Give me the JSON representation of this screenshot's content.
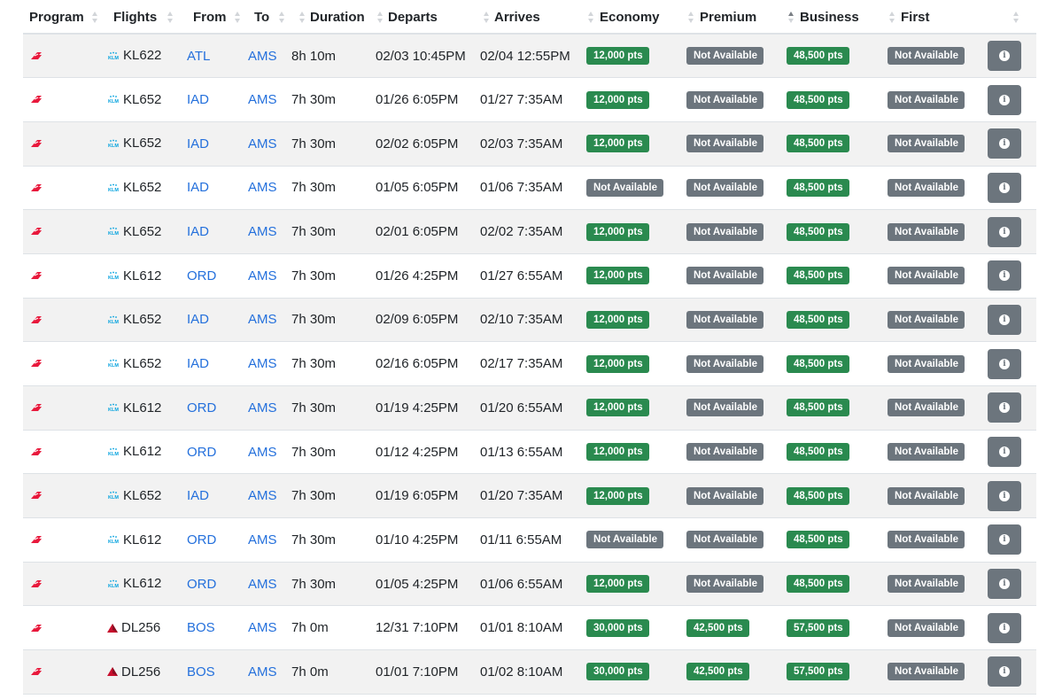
{
  "columns": [
    {
      "label": "Program"
    },
    {
      "label": "Flights"
    },
    {
      "label": "From"
    },
    {
      "label": "To"
    },
    {
      "label": "Duration"
    },
    {
      "label": "Departs"
    },
    {
      "label": "Arrives"
    },
    {
      "label": "Economy"
    },
    {
      "label": "Premium"
    },
    {
      "label": "Business",
      "sorted": "asc"
    },
    {
      "label": "First"
    },
    {
      "label": ""
    }
  ],
  "colors": {
    "available_badge": "#2a8a4f",
    "unavailable_badge": "#6c757d",
    "airport_link": "#2470dc",
    "program_logo": "#e8193c"
  },
  "rows": [
    {
      "program_icon": "program-logo-icon",
      "airline_icon": "klm-logo-icon",
      "flight": "KL622",
      "from": "ATL",
      "to": "AMS",
      "duration": "8h 10m",
      "departs": "02/03 10:45PM",
      "arrives": "02/04 12:55PM",
      "economy": "12,000 pts",
      "premium": "Not Available",
      "business": "48,500 pts",
      "first": "Not Available"
    },
    {
      "program_icon": "program-logo-icon",
      "airline_icon": "klm-logo-icon",
      "flight": "KL652",
      "from": "IAD",
      "to": "AMS",
      "duration": "7h 30m",
      "departs": "01/26 6:05PM",
      "arrives": "01/27 7:35AM",
      "economy": "12,000 pts",
      "premium": "Not Available",
      "business": "48,500 pts",
      "first": "Not Available"
    },
    {
      "program_icon": "program-logo-icon",
      "airline_icon": "klm-logo-icon",
      "flight": "KL652",
      "from": "IAD",
      "to": "AMS",
      "duration": "7h 30m",
      "departs": "02/02 6:05PM",
      "arrives": "02/03 7:35AM",
      "economy": "12,000 pts",
      "premium": "Not Available",
      "business": "48,500 pts",
      "first": "Not Available"
    },
    {
      "program_icon": "program-logo-icon",
      "airline_icon": "klm-logo-icon",
      "flight": "KL652",
      "from": "IAD",
      "to": "AMS",
      "duration": "7h 30m",
      "departs": "01/05 6:05PM",
      "arrives": "01/06 7:35AM",
      "economy": "Not Available",
      "premium": "Not Available",
      "business": "48,500 pts",
      "first": "Not Available"
    },
    {
      "program_icon": "program-logo-icon",
      "airline_icon": "klm-logo-icon",
      "flight": "KL652",
      "from": "IAD",
      "to": "AMS",
      "duration": "7h 30m",
      "departs": "02/01 6:05PM",
      "arrives": "02/02 7:35AM",
      "economy": "12,000 pts",
      "premium": "Not Available",
      "business": "48,500 pts",
      "first": "Not Available"
    },
    {
      "program_icon": "program-logo-icon",
      "airline_icon": "klm-logo-icon",
      "flight": "KL612",
      "from": "ORD",
      "to": "AMS",
      "duration": "7h 30m",
      "departs": "01/26 4:25PM",
      "arrives": "01/27 6:55AM",
      "economy": "12,000 pts",
      "premium": "Not Available",
      "business": "48,500 pts",
      "first": "Not Available"
    },
    {
      "program_icon": "program-logo-icon",
      "airline_icon": "klm-logo-icon",
      "flight": "KL652",
      "from": "IAD",
      "to": "AMS",
      "duration": "7h 30m",
      "departs": "02/09 6:05PM",
      "arrives": "02/10 7:35AM",
      "economy": "12,000 pts",
      "premium": "Not Available",
      "business": "48,500 pts",
      "first": "Not Available"
    },
    {
      "program_icon": "program-logo-icon",
      "airline_icon": "klm-logo-icon",
      "flight": "KL652",
      "from": "IAD",
      "to": "AMS",
      "duration": "7h 30m",
      "departs": "02/16 6:05PM",
      "arrives": "02/17 7:35AM",
      "economy": "12,000 pts",
      "premium": "Not Available",
      "business": "48,500 pts",
      "first": "Not Available"
    },
    {
      "program_icon": "program-logo-icon",
      "airline_icon": "klm-logo-icon",
      "flight": "KL612",
      "from": "ORD",
      "to": "AMS",
      "duration": "7h 30m",
      "departs": "01/19 4:25PM",
      "arrives": "01/20 6:55AM",
      "economy": "12,000 pts",
      "premium": "Not Available",
      "business": "48,500 pts",
      "first": "Not Available"
    },
    {
      "program_icon": "program-logo-icon",
      "airline_icon": "klm-logo-icon",
      "flight": "KL612",
      "from": "ORD",
      "to": "AMS",
      "duration": "7h 30m",
      "departs": "01/12 4:25PM",
      "arrives": "01/13 6:55AM",
      "economy": "12,000 pts",
      "premium": "Not Available",
      "business": "48,500 pts",
      "first": "Not Available"
    },
    {
      "program_icon": "program-logo-icon",
      "airline_icon": "klm-logo-icon",
      "flight": "KL652",
      "from": "IAD",
      "to": "AMS",
      "duration": "7h 30m",
      "departs": "01/19 6:05PM",
      "arrives": "01/20 7:35AM",
      "economy": "12,000 pts",
      "premium": "Not Available",
      "business": "48,500 pts",
      "first": "Not Available"
    },
    {
      "program_icon": "program-logo-icon",
      "airline_icon": "klm-logo-icon",
      "flight": "KL612",
      "from": "ORD",
      "to": "AMS",
      "duration": "7h 30m",
      "departs": "01/10 4:25PM",
      "arrives": "01/11 6:55AM",
      "economy": "Not Available",
      "premium": "Not Available",
      "business": "48,500 pts",
      "first": "Not Available"
    },
    {
      "program_icon": "program-logo-icon",
      "airline_icon": "klm-logo-icon",
      "flight": "KL612",
      "from": "ORD",
      "to": "AMS",
      "duration": "7h 30m",
      "departs": "01/05 4:25PM",
      "arrives": "01/06 6:55AM",
      "economy": "12,000 pts",
      "premium": "Not Available",
      "business": "48,500 pts",
      "first": "Not Available"
    },
    {
      "program_icon": "program-logo-icon",
      "airline_icon": "delta-logo-icon",
      "flight": "DL256",
      "from": "BOS",
      "to": "AMS",
      "duration": "7h 0m",
      "departs": "12/31 7:10PM",
      "arrives": "01/01 8:10AM",
      "economy": "30,000 pts",
      "premium": "42,500 pts",
      "business": "57,500 pts",
      "first": "Not Available"
    },
    {
      "program_icon": "program-logo-icon",
      "airline_icon": "delta-logo-icon",
      "flight": "DL256",
      "from": "BOS",
      "to": "AMS",
      "duration": "7h 0m",
      "departs": "01/01 7:10PM",
      "arrives": "01/02 8:10AM",
      "economy": "30,000 pts",
      "premium": "42,500 pts",
      "business": "57,500 pts",
      "first": "Not Available"
    }
  ]
}
